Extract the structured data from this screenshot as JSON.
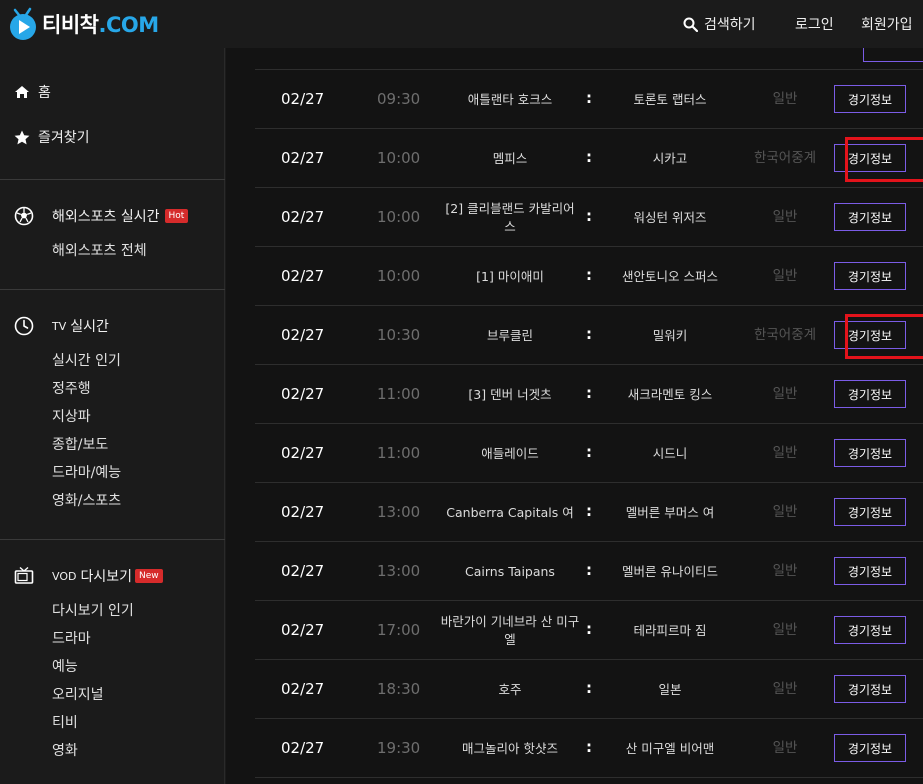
{
  "header": {
    "logo_main": "티비착",
    "logo_suffix": ".COM",
    "search_label": "검색하기",
    "login_label": "로그인",
    "join_label": "회원가입"
  },
  "sidebar": {
    "home": "홈",
    "favorites": "즐겨찾기",
    "sections": [
      {
        "title": "해외스포츠 실시간",
        "badge": "Hot",
        "icon": "soccer-ball-icon",
        "items": [
          "해외스포츠 전체"
        ]
      },
      {
        "title_prefix": "TV",
        "title": "실시간",
        "icon": "clock-icon",
        "items": [
          "실시간 인기",
          "정주행",
          "지상파",
          "종합/보도",
          "드라마/예능",
          "영화/스포츠"
        ]
      },
      {
        "title_prefix": "VOD",
        "title": "다시보기",
        "badge": "New",
        "icon": "tv-icon",
        "items": [
          "다시보기 인기",
          "드라마",
          "예능",
          "오리지널",
          "티비",
          "영화"
        ]
      }
    ]
  },
  "games": [
    {
      "date": "02/27",
      "time": "09:30",
      "home": "애틀랜타 호크스",
      "away": "토론토 랩터스",
      "broadcast": "일반",
      "button": "경기정보",
      "highlighted": false
    },
    {
      "date": "02/27",
      "time": "10:00",
      "home": "멤피스",
      "away": "시카고",
      "broadcast": "한국어중계",
      "button": "경기정보",
      "highlighted": true
    },
    {
      "date": "02/27",
      "time": "10:00",
      "home": "[2] 클리블랜드 카발리어스",
      "away": "워싱턴 위저즈",
      "broadcast": "일반",
      "button": "경기정보",
      "highlighted": false
    },
    {
      "date": "02/27",
      "time": "10:00",
      "home": "[1] 마이애미",
      "away": "샌안토니오 스퍼스",
      "broadcast": "일반",
      "button": "경기정보",
      "highlighted": false
    },
    {
      "date": "02/27",
      "time": "10:30",
      "home": "브루클린",
      "away": "밀워키",
      "broadcast": "한국어중계",
      "button": "경기정보",
      "highlighted": true
    },
    {
      "date": "02/27",
      "time": "11:00",
      "home": "[3] 덴버 너겟츠",
      "away": "새크라멘토 킹스",
      "broadcast": "일반",
      "button": "경기정보",
      "highlighted": false
    },
    {
      "date": "02/27",
      "time": "11:00",
      "home": "애들레이드",
      "away": "시드니",
      "broadcast": "일반",
      "button": "경기정보",
      "highlighted": false
    },
    {
      "date": "02/27",
      "time": "13:00",
      "home": "Canberra Capitals 여",
      "away": "멜버른 부머스 여",
      "broadcast": "일반",
      "button": "경기정보",
      "highlighted": false
    },
    {
      "date": "02/27",
      "time": "13:00",
      "home": "Cairns Taipans",
      "away": "멜버른 유나이티드",
      "broadcast": "일반",
      "button": "경기정보",
      "highlighted": false
    },
    {
      "date": "02/27",
      "time": "17:00",
      "home": "바란가이 기네브라 산 미구엘",
      "away": "테라피르마 짐",
      "broadcast": "일반",
      "button": "경기정보",
      "highlighted": false
    },
    {
      "date": "02/27",
      "time": "18:30",
      "home": "호주",
      "away": "일본",
      "broadcast": "일반",
      "button": "경기정보",
      "highlighted": false
    },
    {
      "date": "02/27",
      "time": "19:30",
      "home": "매그놀리아 핫샷즈",
      "away": "산 미구엘 비어맨",
      "broadcast": "일반",
      "button": "경기정보",
      "highlighted": false
    }
  ],
  "separator": ":",
  "colors": {
    "accent": "#7b5ce6",
    "highlight": "#e3131b",
    "badge": "#d62b2b",
    "logo_blue": "#27a7e8"
  }
}
